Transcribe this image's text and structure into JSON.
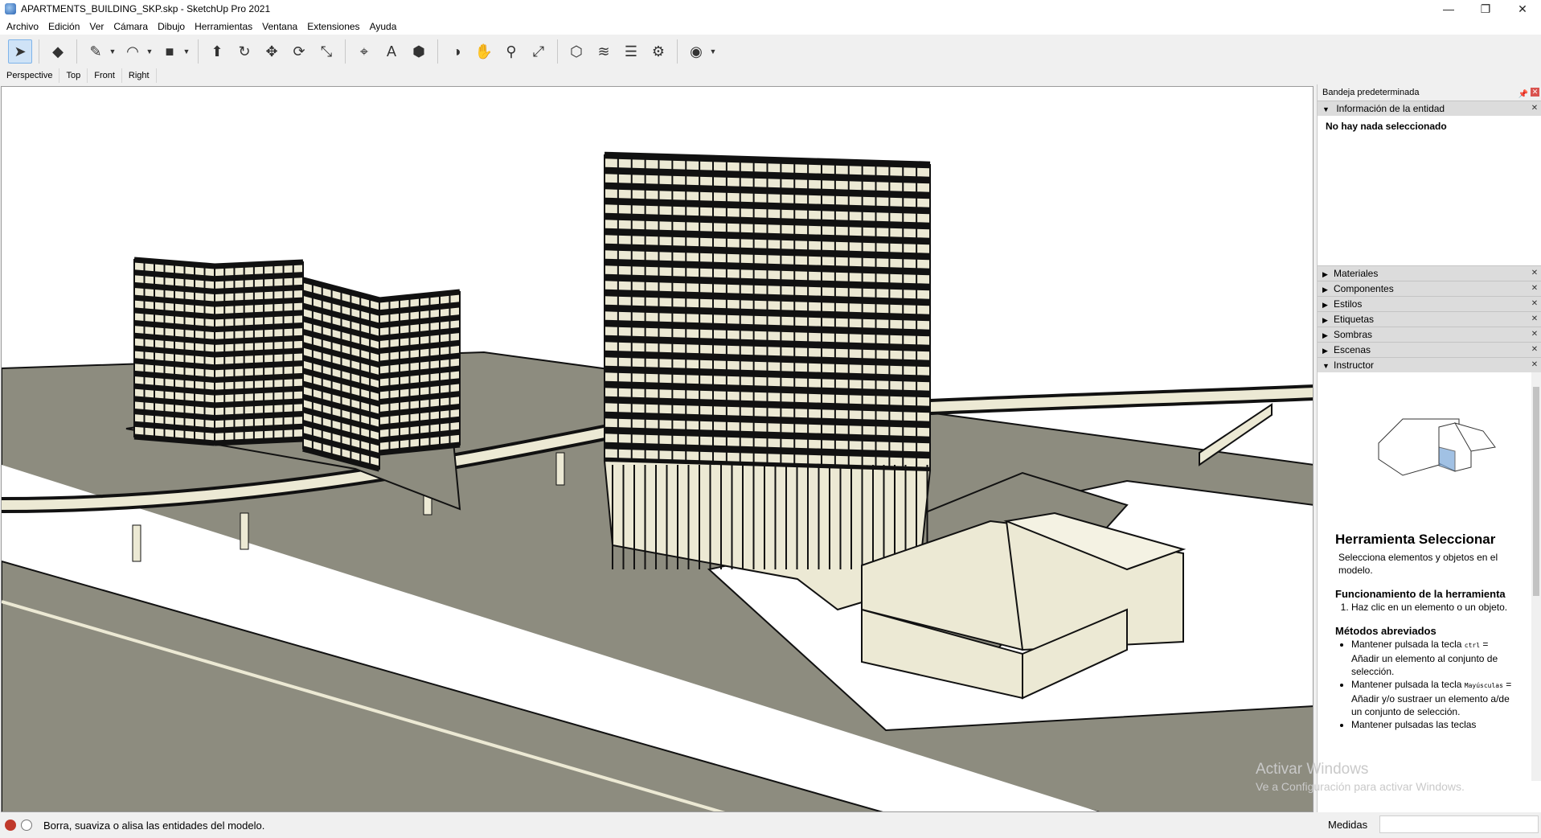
{
  "window": {
    "title": "APARTMENTS_BUILDING_SKP.skp - SketchUp Pro 2021",
    "controls": [
      "—",
      "❐",
      "✕"
    ]
  },
  "menu": [
    "Archivo",
    "Edición",
    "Ver",
    "Cámara",
    "Dibujo",
    "Herramientas",
    "Ventana",
    "Extensiones",
    "Ayuda"
  ],
  "toolbar": {
    "tools": [
      {
        "name": "select-tool",
        "icon": "arrow-cursor-icon",
        "glyph": "➤"
      },
      {
        "name": "eraser-tool",
        "icon": "eraser-icon",
        "glyph": "◆"
      },
      {
        "name": "line-tool",
        "icon": "pencil-icon",
        "glyph": "✎"
      },
      {
        "name": "arc-tool",
        "icon": "arc-icon",
        "glyph": "◠"
      },
      {
        "name": "shape-tool",
        "icon": "rectangle-icon",
        "glyph": "■"
      },
      {
        "name": "push-pull-tool",
        "icon": "push-pull-icon",
        "glyph": "⬆"
      },
      {
        "name": "follow-me-tool",
        "icon": "follow-me-icon",
        "glyph": "↻"
      },
      {
        "name": "move-tool",
        "icon": "move-icon",
        "glyph": "✥"
      },
      {
        "name": "rotate-tool",
        "icon": "rotate-icon",
        "glyph": "⟳"
      },
      {
        "name": "scale-tool",
        "icon": "scale-icon",
        "glyph": "⤡"
      },
      {
        "name": "tape-measure-tool",
        "icon": "tape-measure-icon",
        "glyph": "⌖"
      },
      {
        "name": "text-tool",
        "icon": "text-label-icon",
        "glyph": "A"
      },
      {
        "name": "paint-bucket-tool",
        "icon": "paint-bucket-icon",
        "glyph": "⬢"
      },
      {
        "name": "orbit-tool",
        "icon": "orbit-icon",
        "glyph": "◑"
      },
      {
        "name": "pan-tool",
        "icon": "hand-icon",
        "glyph": "✋"
      },
      {
        "name": "zoom-tool",
        "icon": "magnifier-icon",
        "glyph": "⚲"
      },
      {
        "name": "zoom-extents-tool",
        "icon": "zoom-extents-icon",
        "glyph": "⤢"
      },
      {
        "name": "warehouse-button",
        "icon": "warehouse-icon",
        "glyph": "⬡"
      },
      {
        "name": "extension-warehouse-button",
        "icon": "extension-warehouse-icon",
        "glyph": "≋"
      },
      {
        "name": "layout-button",
        "icon": "layers-icon",
        "glyph": "☰"
      },
      {
        "name": "extension-manager-button",
        "icon": "extension-manager-icon",
        "glyph": "⚙"
      },
      {
        "name": "account-button",
        "icon": "user-account-icon",
        "glyph": "◉"
      }
    ]
  },
  "scenes": [
    "Perspective",
    "Top",
    "Front",
    "Right"
  ],
  "tray": {
    "title": "Bandeja predeterminada",
    "entity_panel": {
      "title": "Información de la entidad",
      "body": "No hay nada seleccionado"
    },
    "panels": [
      "Materiales",
      "Componentes",
      "Estilos",
      "Etiquetas",
      "Sombras",
      "Escenas",
      "Instructor"
    ]
  },
  "instructor": {
    "title": "Herramienta Seleccionar",
    "lead": "Selecciona elementos y objetos en el modelo.",
    "section1": "Funcionamiento de la herramienta",
    "steps": [
      "Haz clic en un elemento o un objeto."
    ],
    "section2": "Métodos abreviados",
    "shortcuts": [
      {
        "pre": "Mantener pulsada la tecla ",
        "key": "ctrl",
        "post": " = Añadir un elemento al conjunto de selección."
      },
      {
        "pre": "Mantener pulsada la tecla ",
        "key": "Mayúsculas",
        "post": " = Añadir y/o sustraer un elemento a/de un conjunto de selección."
      },
      {
        "pre": "Mantener pulsadas las teclas",
        "key": "",
        "post": ""
      }
    ]
  },
  "watermark": {
    "line1": "Activar Windows",
    "line2": "Ve a Configuración para activar Windows."
  },
  "status": {
    "message": "Borra, suaviza o alisa las entidades del modelo.",
    "measurements_label": "Medidas",
    "measurements_value": ""
  },
  "colors": {
    "ground": "#8d8c7f",
    "building": "#ece9d4",
    "accent": "#2a64b3"
  }
}
